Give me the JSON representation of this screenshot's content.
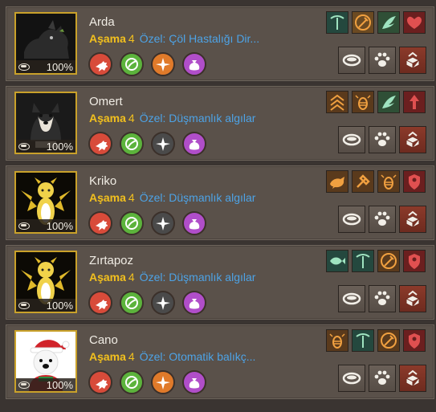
{
  "pets": [
    {
      "name": "Arda",
      "stage_label": "Aşama",
      "stage": "4",
      "special": "Özel: Çöl Hastalığı Dir...",
      "feed": "100%",
      "portrait": "black-wolf",
      "skills": [
        {
          "icon": "beast-icon",
          "color": "#d84b3a"
        },
        {
          "icon": "leaf-icon",
          "color": "#5cb33c"
        },
        {
          "icon": "compass-icon",
          "color": "#e07a2a"
        },
        {
          "icon": "sack-icon",
          "color": "#b04ec9"
        }
      ],
      "traits": [
        {
          "icon": "pickaxe-icon",
          "bg": "#24483e"
        },
        {
          "icon": "axe-icon",
          "bg": "#6b4a22"
        },
        {
          "icon": "wing-icon",
          "bg": "#2f4f36"
        },
        {
          "icon": "heart-shield-icon",
          "bg": "#6b1f1f"
        }
      ]
    },
    {
      "name": "Omert",
      "stage_label": "Aşama",
      "stage": "4",
      "special": "Özel: Düşmanlık algılar",
      "feed": "100%",
      "portrait": "shiba",
      "skills": [
        {
          "icon": "beast-icon",
          "color": "#d84b3a"
        },
        {
          "icon": "leaf-icon",
          "color": "#5cb33c"
        },
        {
          "icon": "compass-icon",
          "color": "#4a4a4a"
        },
        {
          "icon": "sack-icon",
          "color": "#b04ec9"
        }
      ],
      "traits": [
        {
          "icon": "chevron-icon",
          "bg": "#5a3a1c"
        },
        {
          "icon": "bee-icon",
          "bg": "#5a3a1c"
        },
        {
          "icon": "wing-icon",
          "bg": "#2f4f36"
        },
        {
          "icon": "arrow-up-icon",
          "bg": "#6b1f1f"
        }
      ]
    },
    {
      "name": "Kriko",
      "stage_label": "Aşama",
      "stage": "4",
      "special": "Özel: Düşmanlık algılar",
      "feed": "100%",
      "portrait": "gold-dragon",
      "skills": [
        {
          "icon": "beast-icon",
          "color": "#d84b3a"
        },
        {
          "icon": "leaf-icon",
          "color": "#5cb33c"
        },
        {
          "icon": "compass-icon",
          "color": "#4a4a4a"
        },
        {
          "icon": "sack-icon",
          "color": "#b04ec9"
        }
      ],
      "traits": [
        {
          "icon": "bird-icon",
          "bg": "#5a3a1c"
        },
        {
          "icon": "hammer-icon",
          "bg": "#5a3a1c"
        },
        {
          "icon": "bee-icon",
          "bg": "#5a3a1c"
        },
        {
          "icon": "shield-person-icon",
          "bg": "#6b1f1f"
        }
      ]
    },
    {
      "name": "Zırtapoz",
      "stage_label": "Aşama",
      "stage": "4",
      "special": "Özel: Düşmanlık algılar",
      "feed": "100%",
      "portrait": "gold-dragon",
      "skills": [
        {
          "icon": "beast-icon",
          "color": "#d84b3a"
        },
        {
          "icon": "leaf-icon",
          "color": "#5cb33c"
        },
        {
          "icon": "compass-icon",
          "color": "#4a4a4a"
        },
        {
          "icon": "sack-icon",
          "color": "#b04ec9"
        }
      ],
      "traits": [
        {
          "icon": "fish-icon",
          "bg": "#24483e"
        },
        {
          "icon": "pickaxe-icon",
          "bg": "#24483e"
        },
        {
          "icon": "axe-icon",
          "bg": "#5a3a1c"
        },
        {
          "icon": "shield-person-icon",
          "bg": "#6b1f1f"
        }
      ]
    },
    {
      "name": "Cano",
      "stage_label": "Aşama",
      "stage": "4",
      "special": "Özel: Otomatik balıkç...",
      "feed": "100%",
      "portrait": "santa-bear",
      "skills": [
        {
          "icon": "beast-icon",
          "color": "#d84b3a"
        },
        {
          "icon": "leaf-icon",
          "color": "#5cb33c"
        },
        {
          "icon": "compass-icon",
          "color": "#e07a2a"
        },
        {
          "icon": "sack-icon",
          "color": "#b04ec9"
        }
      ],
      "traits": [
        {
          "icon": "bee-icon",
          "bg": "#5a3a1c"
        },
        {
          "icon": "pickaxe-icon",
          "bg": "#24483e"
        },
        {
          "icon": "axe-icon",
          "bg": "#5a3a1c"
        },
        {
          "icon": "shield-person-icon",
          "bg": "#6b1f1f"
        }
      ]
    }
  ],
  "actions": [
    {
      "icon": "feed-bowl-icon",
      "kind": "normal"
    },
    {
      "icon": "paw-icon",
      "kind": "normal"
    },
    {
      "icon": "release-box-icon",
      "kind": "danger"
    }
  ],
  "colors": {
    "stage": "#f2c01e",
    "special": "#4da3e6",
    "frame": "#c9a12a"
  }
}
